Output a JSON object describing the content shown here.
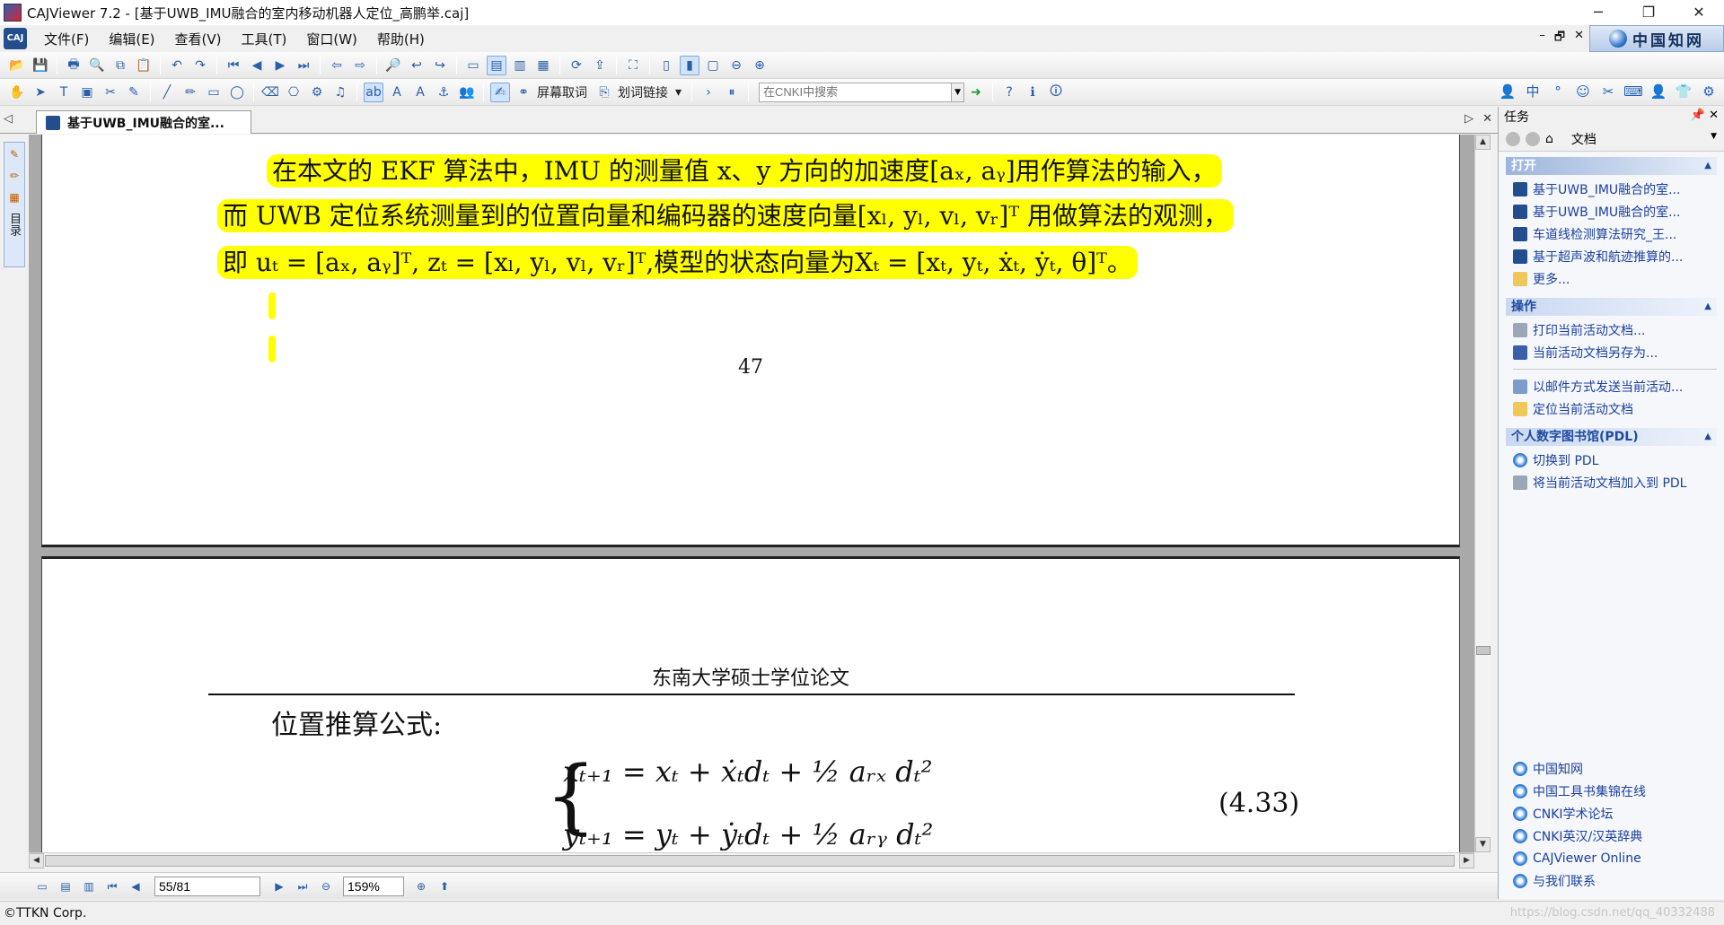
{
  "window": {
    "title": "CAJViewer 7.2 - [基于UWB_IMU融合的室内移动机器人定位_高鹏举.caj]",
    "controls": [
      "─",
      "❐",
      "✕"
    ]
  },
  "menu": {
    "items": [
      "文件(F)",
      "编辑(E)",
      "查看(V)",
      "工具(T)",
      "窗口(W)",
      "帮助(H)"
    ],
    "mdi_controls": [
      "–",
      "🗗",
      "✕"
    ],
    "cnki_badge": "中国知网"
  },
  "toolbar": {
    "screen_word_label": "屏幕取词",
    "word_link_label": "划词链接",
    "search_placeholder": "在CNKI中搜索"
  },
  "tab": {
    "label": "基于UWB_IMU融合的室..."
  },
  "leftbar": {
    "vertical_label": "目录"
  },
  "document": {
    "page1": {
      "line1": "在本文的 EKF 算法中，IMU 的测量值 x、y 方向的加速度[aₓ, aᵧ]用作算法的输入，",
      "line2": "而 UWB 定位系统测量到的位置向量和编码器的速度向量[xₗ, yₗ, vₗ, vᵣ]ᵀ 用做算法的观测，",
      "line3": "即 uₜ = [aₓ, aᵧ]ᵀ, zₜ = [xₗ, yₗ, vₗ, vᵣ]ᵀ,模型的状态向量为Xₜ = [xₜ, yₜ, ẋₜ, ẏₜ, θ]ᵀ。",
      "page_number": "47"
    },
    "page2": {
      "running_head": "东南大学硕士学位论文",
      "subheading": "位置推算公式:",
      "formula_line1": "xₜ₊₁ = xₜ + ẋₜdₜ + ½ aᵣₓ dₜ²",
      "formula_line2": "yₜ₊₁ = yₜ + ẏₜdₜ + ½ aᵣᵧ dₜ²",
      "equation_number": "(4.33)"
    }
  },
  "navbar": {
    "page_value": "55/81",
    "zoom_value": "159%"
  },
  "status": {
    "text": "©TTKN Corp.",
    "watermark": "https://blog.csdn.net/qq_40332488"
  },
  "taskpanel": {
    "title": "任务",
    "nav_label": "文档",
    "sections": {
      "open": {
        "title": "打开",
        "items": [
          "基于UWB_IMU融合的室...",
          "基于UWB_IMU融合的室...",
          "车道线检测算法研究_王...",
          "基于超声波和航迹推算的...",
          "更多..."
        ]
      },
      "ops": {
        "title": "操作",
        "items": [
          "打印当前活动文档...",
          "当前活动文档另存为...",
          "以邮件方式发送当前活动...",
          "定位当前活动文档"
        ]
      },
      "pdl": {
        "title": "个人数字图书馆(PDL)",
        "items": [
          "切换到 PDL",
          "将当前活动文档加入到 PDL"
        ]
      }
    },
    "links": [
      "中国知网",
      "中国工具书集锦在线",
      "CNKI学术论坛",
      "CNKI英汉/汉英辞典",
      "CAJViewer Online",
      "与我们联系"
    ]
  }
}
